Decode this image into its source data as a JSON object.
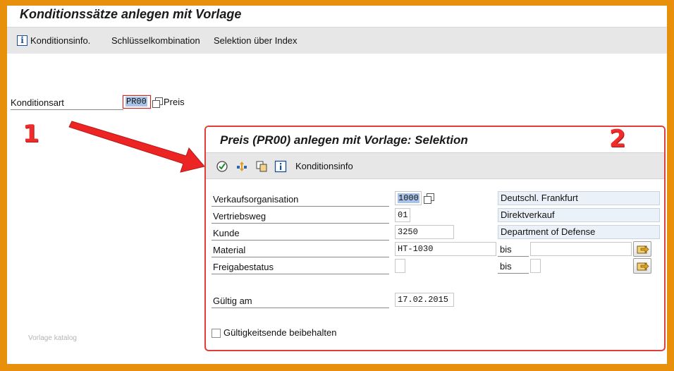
{
  "window": {
    "title": "Konditionssätze anlegen mit Vorlage"
  },
  "toolbar": {
    "items": [
      {
        "label": "Konditionsinfo.",
        "icon": "info-icon"
      },
      {
        "label": "Schlüsselkombination"
      },
      {
        "label": "Selektion über Index"
      }
    ]
  },
  "condition_type": {
    "label": "Konditionsart",
    "value": "PR00",
    "description": "Preis"
  },
  "annotations": {
    "marker_1": "1",
    "marker_2": "2",
    "watermark": "Vorlage katalog"
  },
  "dialog": {
    "title": "Preis (PR00) anlegen mit Vorlage: Selektion",
    "toolbar": {
      "icons": [
        "execute-icon",
        "multiple-selection-icon",
        "copy-icon",
        "info-icon"
      ],
      "info_label": "Konditionsinfo"
    },
    "fields": [
      {
        "label": "Verkaufsorganisation",
        "value": "1000",
        "description": "Deutschl. Frankfurt"
      },
      {
        "label": "Vertriebsweg",
        "value": "01",
        "description": "Direktverkauf"
      },
      {
        "label": "Kunde",
        "value": "3250",
        "description": "Department of Defense"
      },
      {
        "label": "Material",
        "value": "HT-1030",
        "to_label": "bis",
        "to_value": ""
      },
      {
        "label": "Freigabestatus",
        "value": "",
        "to_label": "bis",
        "to_value": ""
      }
    ],
    "valid_on": {
      "label": "Gültig am",
      "value": "17.02.2015"
    },
    "keep_validity_end": {
      "label": "Gültigkeitsende beibehalten",
      "checked": false
    }
  },
  "colors": {
    "frame": "#e8900c",
    "highlight": "#e03d3d",
    "selection": "#3f6db4"
  }
}
